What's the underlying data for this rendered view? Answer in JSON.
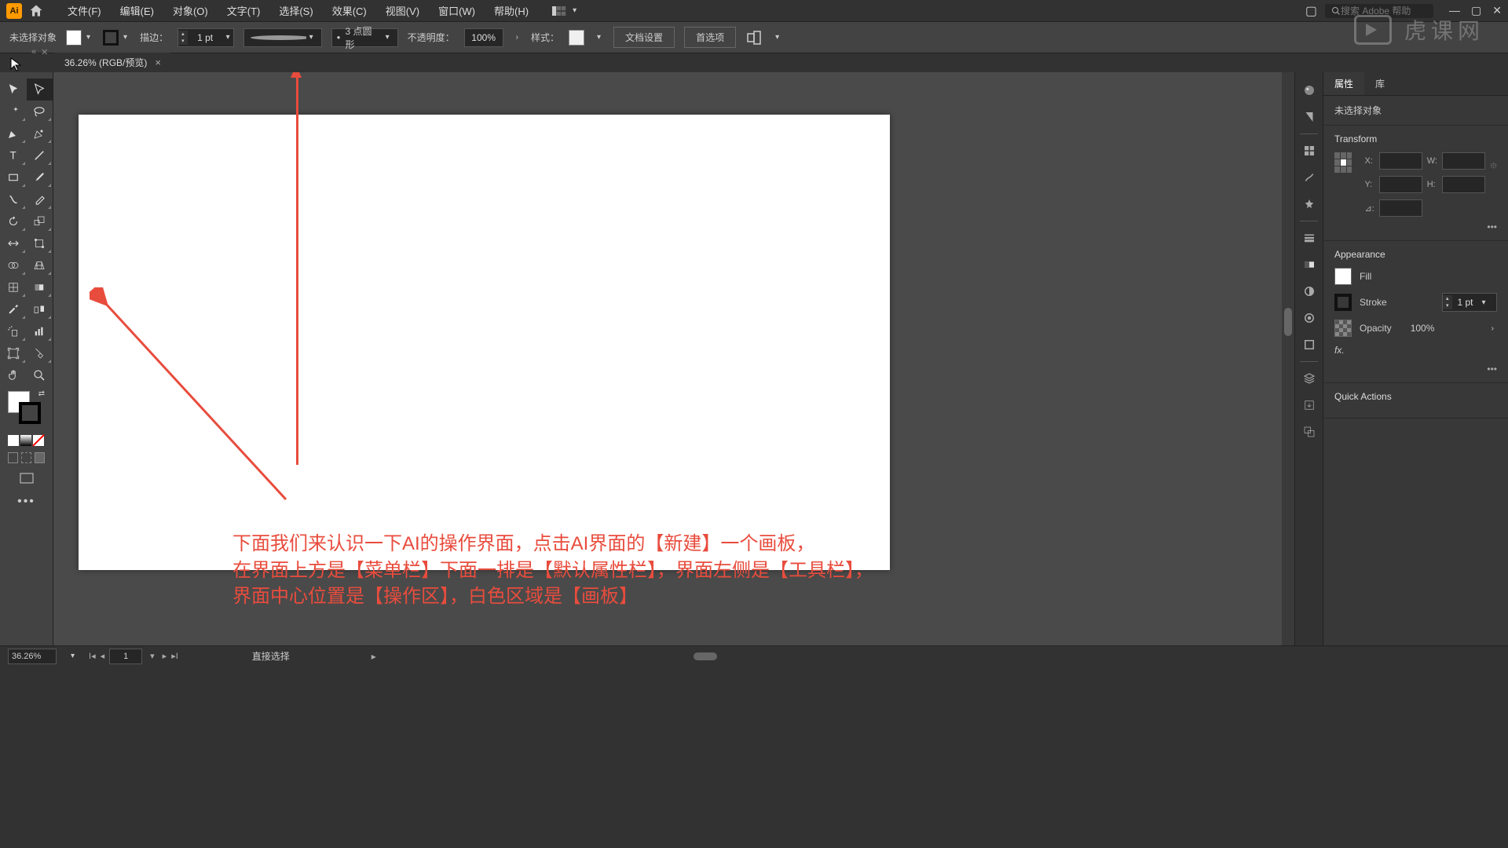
{
  "menubar": {
    "items": [
      "文件(F)",
      "编辑(E)",
      "对象(O)",
      "文字(T)",
      "选择(S)",
      "效果(C)",
      "视图(V)",
      "窗口(W)",
      "帮助(H)"
    ],
    "search_placeholder": "搜索 Adobe 帮助"
  },
  "controlbar": {
    "no_selection": "未选择对象",
    "stroke_label": "描边：",
    "stroke_value": "1 pt",
    "brush_label": "3 点圆形",
    "opacity_label": "不透明度：",
    "opacity_value": "100%",
    "style_label": "样式：",
    "doc_setup": "文档设置",
    "preferences": "首选项"
  },
  "tab": {
    "title": "36.26% (RGB/预览)"
  },
  "annotation": {
    "line1": "下面我们来认识一下AI的操作界面，点击AI界面的【新建】一个画板，",
    "line2": "在界面上方是【菜单栏】下面一排是【默认属性栏】，界面左侧是【工具栏】，",
    "line3": "界面中心位置是【操作区】，白色区域是【画板】"
  },
  "panel": {
    "tab_properties": "属性",
    "tab_library": "库",
    "no_selection": "未选择对象",
    "transform_heading": "Transform",
    "x_label": "X:",
    "y_label": "Y:",
    "w_label": "W:",
    "h_label": "H:",
    "angle_label": "⊿:",
    "appearance_heading": "Appearance",
    "fill_label": "Fill",
    "stroke_label": "Stroke",
    "stroke_val": "1 pt",
    "opacity_label": "Opacity",
    "opacity_val": "100%",
    "fx_label": "fx.",
    "quick_actions": "Quick Actions"
  },
  "status": {
    "zoom": "36.26%",
    "artboard_num": "1",
    "tool_hint": "直接选择"
  },
  "watermark": "虎课网"
}
